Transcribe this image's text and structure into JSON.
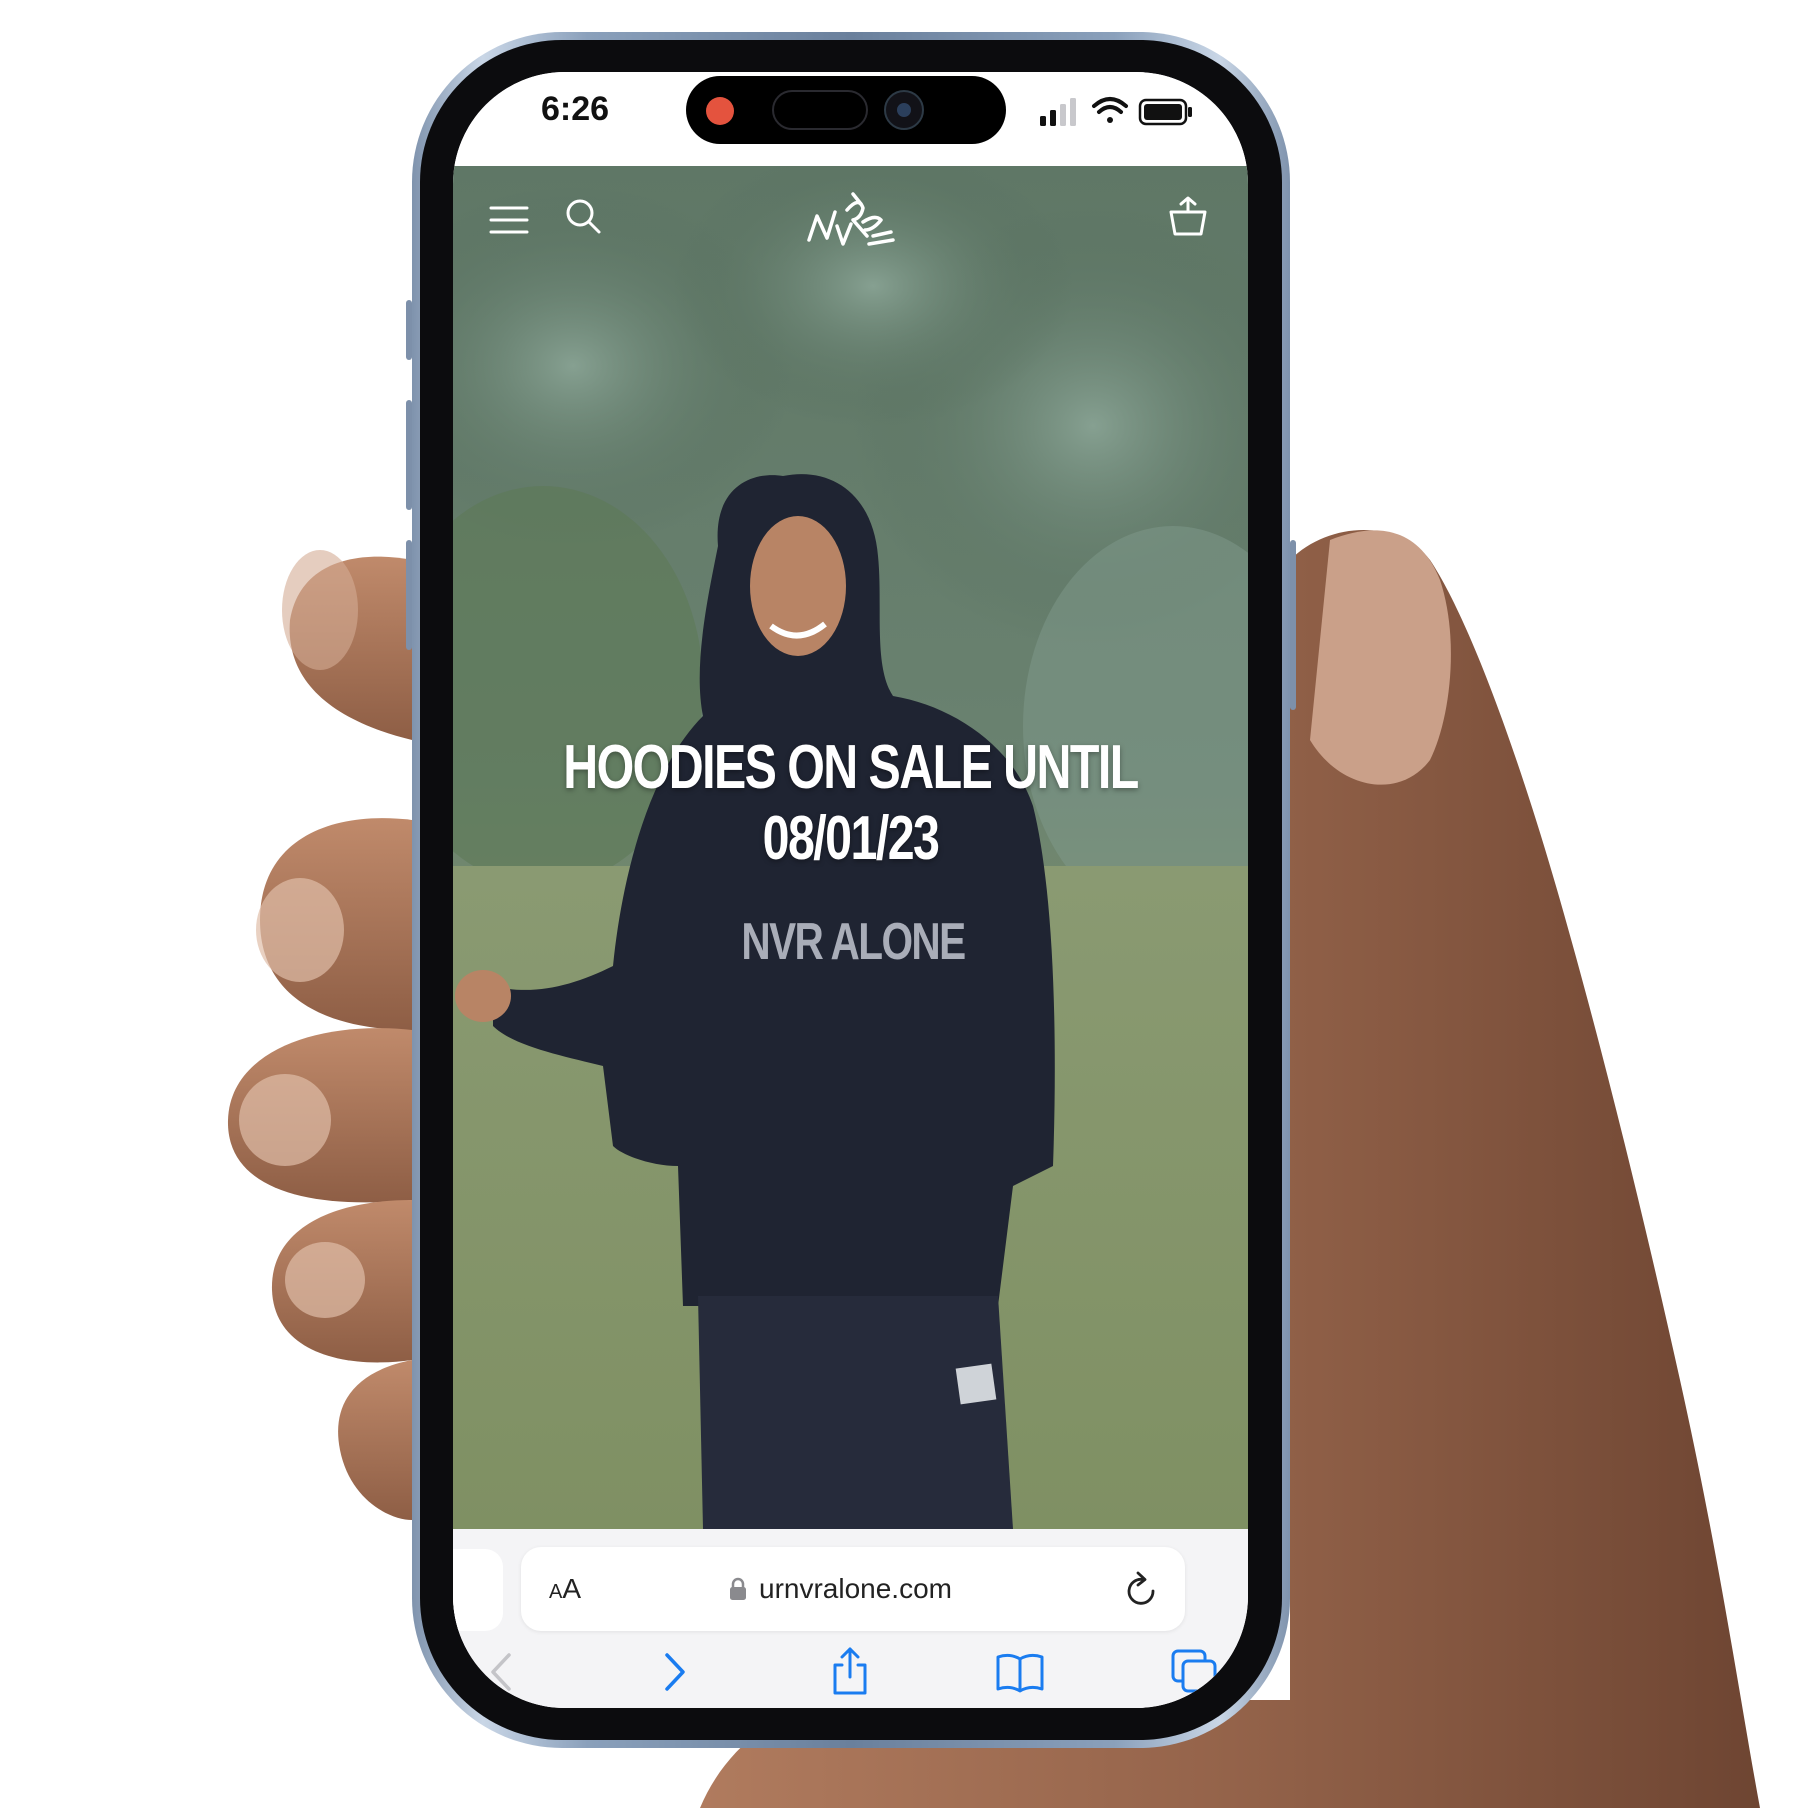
{
  "status_bar": {
    "time": "6:26"
  },
  "site": {
    "logo_alt": "NVR ALONE",
    "hero_headline": "HOODIES ON SALE UNTIL 08/01/23",
    "hoodie_print": "NVR ALONE"
  },
  "safari": {
    "text_size_label_small": "A",
    "text_size_label_large": "A",
    "url": "urnvralone.com"
  },
  "icons": {
    "menu": "menu-icon",
    "search": "search-icon",
    "cart": "basket-icon",
    "lock": "lock-icon",
    "reload": "reload-icon",
    "back": "chevron-left-icon",
    "forward": "chevron-right-icon",
    "share": "share-icon",
    "bookmarks": "book-icon",
    "tabs": "tabs-icon"
  },
  "colors": {
    "safari_accent": "#1a7cf0",
    "headline": "#ffffff",
    "island_indicator": "#e4533e"
  }
}
